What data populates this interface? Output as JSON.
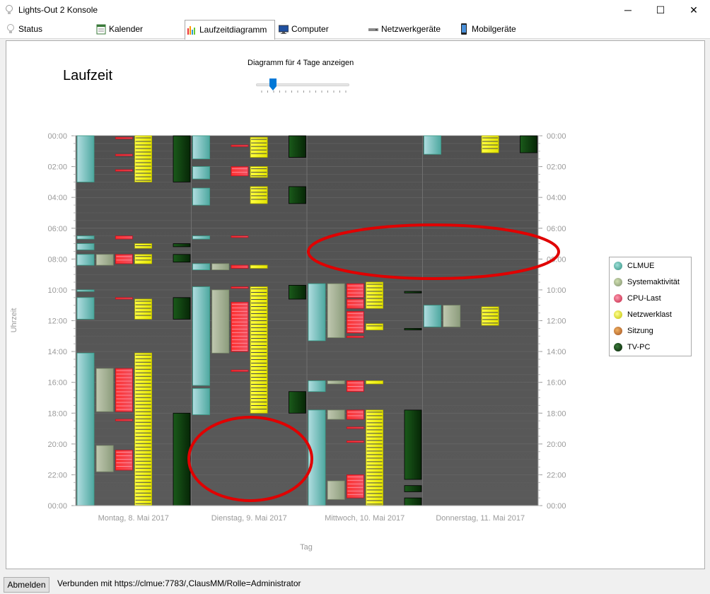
{
  "window": {
    "title": "Lights-Out 2 Konsole",
    "minimize": "─",
    "maximize": "☐",
    "close": "✕"
  },
  "tabs": [
    {
      "label": "Status",
      "icon": "lightbulb-icon"
    },
    {
      "label": "Kalender",
      "icon": "calendar-icon"
    },
    {
      "label": "Laufzeitdiagramm",
      "icon": "bar-chart-icon",
      "active": true
    },
    {
      "label": "Computer",
      "icon": "computer-icon"
    },
    {
      "label": "Netzwerkgeräte",
      "icon": "network-device-icon"
    },
    {
      "label": "Mobilgeräte",
      "icon": "mobile-phone-icon"
    }
  ],
  "main": {
    "heading": "Laufzeit",
    "slider_label": "Diagramm für 4 Tage anzeigen",
    "slider_value": 4
  },
  "chart_data": {
    "type": "bar",
    "ylabel": "Uhrzeit",
    "xlabel": "Tag",
    "y_ticks": [
      "00:00",
      "02:00",
      "04:00",
      "06:00",
      "08:00",
      "10:00",
      "12:00",
      "14:00",
      "16:00",
      "18:00",
      "20:00",
      "22:00",
      "00:00"
    ],
    "ylim": [
      0,
      24
    ],
    "categories": [
      "Montag, 8. Mai 2017",
      "Dienstag, 9. Mai 2017",
      "Mittwoch, 10. Mai 2017",
      "Donnerstag, 11. Mai 2017"
    ],
    "legend_position": "right",
    "colors": {
      "CLMUE": "#6fb8b5",
      "Systemaktivität": "#a8b890",
      "CPU-Last": "#e34b5c",
      "Netzwerklast": "#e8e800",
      "Sitzung": "#d08040",
      "TV-PC": "#0f3d0f"
    },
    "series": [
      {
        "name": "CLMUE",
        "intervals": [
          [
            0,
            0.0,
            3.0
          ],
          [
            0,
            6.5,
            6.7
          ],
          [
            0,
            7.0,
            7.4
          ],
          [
            0,
            7.7,
            8.4
          ],
          [
            0,
            10.0,
            10.1
          ],
          [
            0,
            10.5,
            11.9
          ],
          [
            0,
            14.1,
            24.0
          ],
          [
            1,
            0.0,
            1.5
          ],
          [
            1,
            2.0,
            2.8
          ],
          [
            1,
            3.4,
            4.5
          ],
          [
            1,
            6.5,
            6.7
          ],
          [
            1,
            8.3,
            8.7
          ],
          [
            1,
            9.8,
            16.2
          ],
          [
            1,
            16.4,
            18.1
          ],
          [
            2,
            9.6,
            13.3
          ],
          [
            2,
            15.9,
            16.6
          ],
          [
            2,
            17.8,
            24.0
          ],
          [
            3,
            0.0,
            1.2
          ],
          [
            3,
            11.0,
            12.4
          ]
        ]
      },
      {
        "name": "Systemaktivität",
        "intervals": [
          [
            0,
            7.7,
            8.4
          ],
          [
            0,
            15.1,
            17.9
          ],
          [
            0,
            20.1,
            21.8
          ],
          [
            1,
            8.3,
            8.7
          ],
          [
            1,
            10.0,
            14.1
          ],
          [
            2,
            9.6,
            13.1
          ],
          [
            2,
            15.9,
            16.1
          ],
          [
            2,
            17.8,
            18.4
          ],
          [
            2,
            22.4,
            23.6
          ],
          [
            3,
            11.0,
            12.4
          ]
        ]
      },
      {
        "name": "CPU-Last",
        "intervals": [
          [
            0,
            0.1,
            0.2
          ],
          [
            0,
            1.2,
            1.3
          ],
          [
            0,
            2.2,
            2.3
          ],
          [
            0,
            6.5,
            6.7
          ],
          [
            0,
            7.7,
            8.3
          ],
          [
            0,
            10.5,
            10.6
          ],
          [
            0,
            15.1,
            17.9
          ],
          [
            0,
            18.4,
            18.5
          ],
          [
            0,
            20.4,
            21.7
          ],
          [
            1,
            0.6,
            0.7
          ],
          [
            1,
            2.0,
            2.6
          ],
          [
            1,
            6.5,
            6.6
          ],
          [
            1,
            8.4,
            8.6
          ],
          [
            1,
            9.8,
            9.9
          ],
          [
            1,
            10.8,
            14.0
          ],
          [
            1,
            15.2,
            15.3
          ],
          [
            2,
            9.6,
            10.5
          ],
          [
            2,
            10.6,
            11.2
          ],
          [
            2,
            11.4,
            12.8
          ],
          [
            2,
            13.0,
            13.1
          ],
          [
            2,
            15.9,
            16.6
          ],
          [
            2,
            17.8,
            18.4
          ],
          [
            2,
            18.9,
            19.0
          ],
          [
            2,
            19.8,
            19.9
          ],
          [
            2,
            22.0,
            23.5
          ]
        ]
      },
      {
        "name": "Netzwerklast",
        "intervals": [
          [
            0,
            0.0,
            3.0
          ],
          [
            0,
            7.0,
            7.3
          ],
          [
            0,
            7.7,
            8.3
          ],
          [
            0,
            10.6,
            11.9
          ],
          [
            0,
            14.1,
            24.0
          ],
          [
            1,
            0.1,
            1.4
          ],
          [
            1,
            2.0,
            2.7
          ],
          [
            1,
            3.3,
            4.4
          ],
          [
            1,
            8.4,
            8.6
          ],
          [
            1,
            9.8,
            18.0
          ],
          [
            2,
            9.5,
            11.2
          ],
          [
            2,
            12.2,
            12.6
          ],
          [
            2,
            15.9,
            16.1
          ],
          [
            2,
            17.8,
            24.0
          ],
          [
            3,
            0.0,
            1.1
          ],
          [
            3,
            11.1,
            12.3
          ]
        ]
      },
      {
        "name": "Sitzung",
        "intervals": []
      },
      {
        "name": "TV-PC",
        "intervals": [
          [
            0,
            0.0,
            3.0
          ],
          [
            0,
            7.0,
            7.2
          ],
          [
            0,
            7.7,
            8.2
          ],
          [
            0,
            10.5,
            11.9
          ],
          [
            0,
            18.0,
            24.0
          ],
          [
            1,
            0.0,
            1.4
          ],
          [
            1,
            3.3,
            4.4
          ],
          [
            1,
            9.7,
            10.6
          ],
          [
            1,
            16.6,
            18.0
          ],
          [
            2,
            10.1,
            10.2
          ],
          [
            2,
            12.5,
            12.6
          ],
          [
            2,
            17.8,
            22.3
          ],
          [
            2,
            22.7,
            23.1
          ],
          [
            2,
            23.5,
            24.0
          ],
          [
            3,
            0.0,
            1.1
          ]
        ]
      }
    ]
  },
  "status": {
    "logout_label": "Abmelden",
    "connection_text": "Verbunden  mit  https://clmue:7783/,ClausMM/Rolle=Administrator"
  }
}
